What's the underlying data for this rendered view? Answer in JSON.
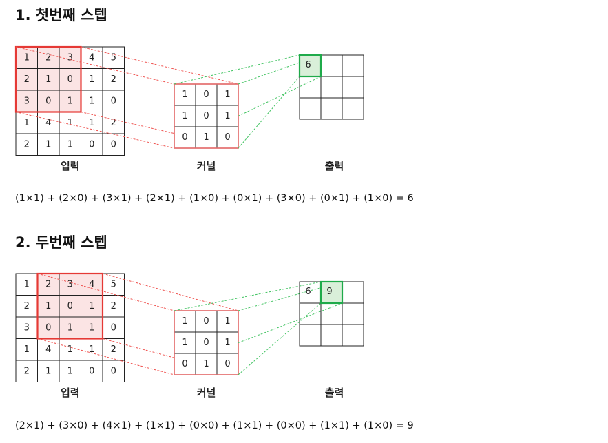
{
  "steps": [
    {
      "title": "1. 첫번째 스텝",
      "input": [
        [
          1,
          2,
          3,
          4,
          5
        ],
        [
          2,
          1,
          0,
          1,
          2
        ],
        [
          3,
          0,
          1,
          1,
          0
        ],
        [
          1,
          4,
          1,
          1,
          2
        ],
        [
          2,
          1,
          1,
          0,
          0
        ]
      ],
      "window": {
        "row": 0,
        "col": 0
      },
      "kernel": [
        [
          1,
          0,
          1
        ],
        [
          1,
          0,
          1
        ],
        [
          0,
          1,
          0
        ]
      ],
      "output": [
        [
          "6",
          "",
          ""
        ],
        [
          "",
          "",
          ""
        ],
        [
          "",
          "",
          ""
        ]
      ],
      "highlight": {
        "row": 0,
        "col": 0
      },
      "labels": {
        "input": "입력",
        "kernel": "커널",
        "output": "출력"
      },
      "formula": "(1×1) + (2×0) + (3×1) + (2×1) + (1×0) + (0×1) + (3×0) + (0×1) + (1×0) = 6"
    },
    {
      "title": "2. 두번째 스텝",
      "input": [
        [
          1,
          2,
          3,
          4,
          5
        ],
        [
          2,
          1,
          0,
          1,
          2
        ],
        [
          3,
          0,
          1,
          1,
          0
        ],
        [
          1,
          4,
          1,
          1,
          2
        ],
        [
          2,
          1,
          1,
          0,
          0
        ]
      ],
      "window": {
        "row": 0,
        "col": 1
      },
      "kernel": [
        [
          1,
          0,
          1
        ],
        [
          1,
          0,
          1
        ],
        [
          0,
          1,
          0
        ]
      ],
      "output": [
        [
          "6",
          "9",
          ""
        ],
        [
          "",
          "",
          ""
        ],
        [
          "",
          "",
          ""
        ]
      ],
      "highlight": {
        "row": 0,
        "col": 1
      },
      "labels": {
        "input": "입력",
        "kernel": "커널",
        "output": "출력"
      },
      "formula": "(2×1) + (3×0) + (4×1) + (1×1) + (0×0) + (1×1) + (0×0) + (1×1) + (1×0) = 9"
    }
  ],
  "colors": {
    "window_stroke": "#e53935",
    "window_fill": "#fbe4e4",
    "kernel_stroke": "#e57373",
    "red_guides": "#ef5350",
    "green_guides": "#43c463",
    "output_highlight_stroke": "#1faa4a",
    "output_highlight_fill": "#d9efd9",
    "grid": "#222222"
  }
}
